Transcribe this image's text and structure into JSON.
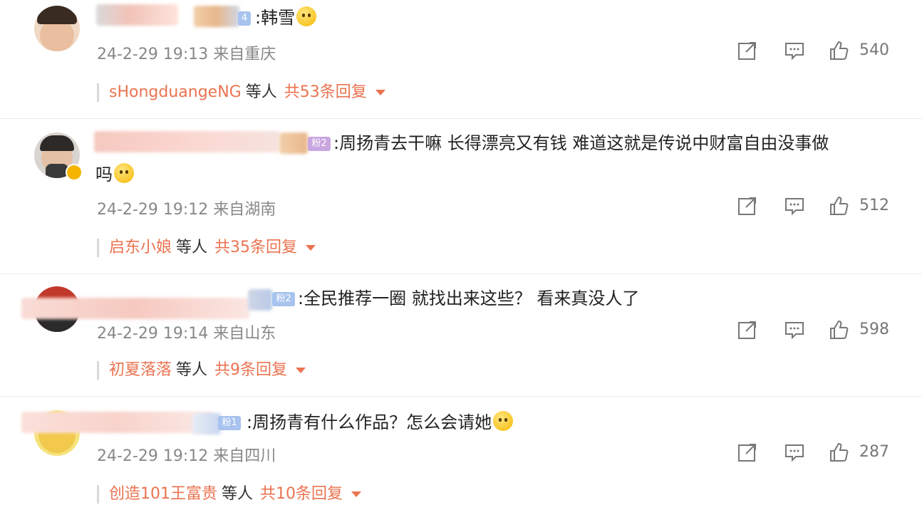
{
  "comments": [
    {
      "text": ":韩雪",
      "emoji": "surprised-face-emoji",
      "time": "24-2-29 19:13 来自重庆",
      "likes": "540",
      "reply_user": "sHongduangeNG",
      "reply_etc": "等人",
      "reply_count": "共53条回复"
    },
    {
      "text": ":周扬青去干嘛 长得漂亮又有钱 难道这就是传说中财富自由没事做",
      "text2": "吗",
      "badge": "粉2",
      "emoji": "grinning-face-emoji",
      "time": "24-2-29 19:12 来自湖南",
      "likes": "512",
      "reply_user": "启东小娘",
      "reply_etc": "等人",
      "reply_count": "共35条回复"
    },
    {
      "text": ":全民推荐一圈 就找出来这些？ 看来真没人了",
      "badge": "粉2",
      "time": "24-2-29 19:14 来自山东",
      "likes": "598",
      "reply_user": "初夏落落",
      "reply_etc": "等人",
      "reply_count": "共9条回复"
    },
    {
      "text": ":周扬青有什么作品？怎么会请她",
      "badge": "粉1",
      "emoji": "tears-of-joy-emoji",
      "time": "24-2-29 19:12 来自四川",
      "likes": "287",
      "reply_user": "创造101王富贵",
      "reply_etc": "等人",
      "reply_count": "共10条回复"
    }
  ],
  "colors": {
    "accent": "#eb7350",
    "meta": "#888888",
    "separator": "#ececec"
  }
}
